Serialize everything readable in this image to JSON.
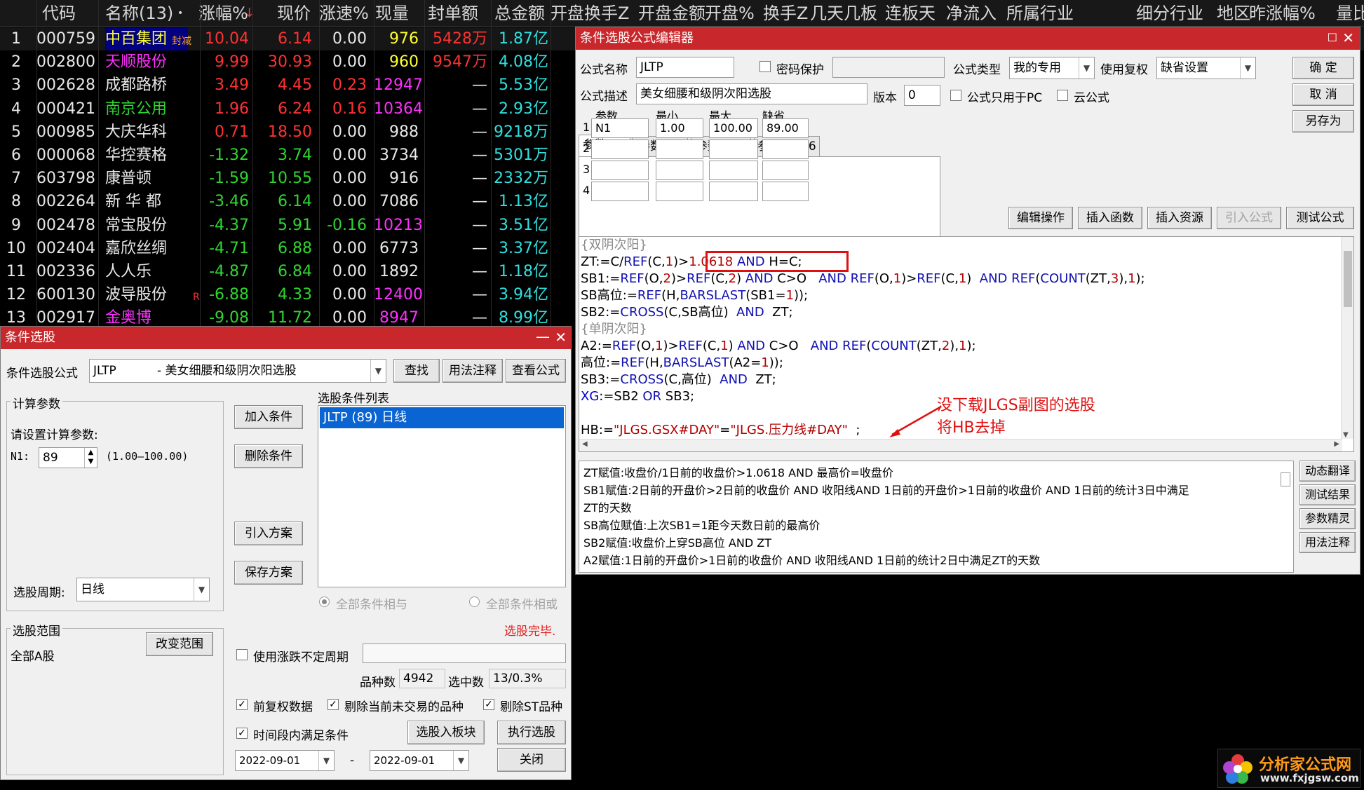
{
  "stock_table": {
    "headers": [
      "代码",
      "名称(13)",
      "•",
      "涨幅%",
      "现价",
      "涨速%",
      "现量",
      "封单额",
      "总金额",
      "开盘换手Z",
      "开盘金额",
      "开盘%",
      "换手Z",
      "几天几板",
      "连板天",
      "净流入",
      "所属行业",
      "细分行业",
      "地区",
      "昨涨幅%",
      "量比"
    ],
    "sort_indicator": "↓",
    "rows": [
      {
        "idx": "1",
        "code": "000759",
        "name": "中百集团",
        "flag": "封减",
        "chg": "10.04",
        "price": "6.14",
        "speed": "0.00",
        "vol": "976",
        "seal": "5428万",
        "amount": "1.87亿"
      },
      {
        "idx": "2",
        "code": "002800",
        "name": "天顺股份",
        "flag": "",
        "chg": "9.99",
        "price": "30.93",
        "speed": "0.00",
        "vol": "960",
        "seal": "9547万",
        "amount": "4.08亿"
      },
      {
        "idx": "3",
        "code": "002628",
        "name": "成都路桥",
        "flag": "",
        "chg": "3.49",
        "price": "4.45",
        "speed": "0.23",
        "vol": "12947",
        "seal": "—",
        "amount": "5.53亿"
      },
      {
        "idx": "4",
        "code": "000421",
        "name": "南京公用",
        "flag": "",
        "chg": "1.96",
        "price": "6.24",
        "speed": "0.16",
        "vol": "10364",
        "seal": "—",
        "amount": "2.93亿"
      },
      {
        "idx": "5",
        "code": "000985",
        "name": "大庆华科",
        "flag": "",
        "chg": "0.71",
        "price": "18.50",
        "speed": "0.00",
        "vol": "988",
        "seal": "—",
        "amount": "9218万"
      },
      {
        "idx": "6",
        "code": "000068",
        "name": "华控赛格",
        "flag": "",
        "chg": "-1.32",
        "price": "3.74",
        "speed": "0.00",
        "vol": "3734",
        "seal": "—",
        "amount": "5301万"
      },
      {
        "idx": "7",
        "code": "603798",
        "name": "康普顿",
        "flag": "",
        "chg": "-1.59",
        "price": "10.55",
        "speed": "0.00",
        "vol": "916",
        "seal": "—",
        "amount": "2332万"
      },
      {
        "idx": "8",
        "code": "002264",
        "name": "新 华 都",
        "flag": "",
        "chg": "-3.46",
        "price": "6.14",
        "speed": "0.00",
        "vol": "7086",
        "seal": "—",
        "amount": "1.13亿"
      },
      {
        "idx": "9",
        "code": "002478",
        "name": "常宝股份",
        "flag": "",
        "chg": "-4.37",
        "price": "5.91",
        "speed": "-0.16",
        "vol": "10213",
        "seal": "—",
        "amount": "3.51亿"
      },
      {
        "idx": "10",
        "code": "002404",
        "name": "嘉欣丝绸",
        "flag": "",
        "chg": "-4.71",
        "price": "6.88",
        "speed": "0.00",
        "vol": "6773",
        "seal": "—",
        "amount": "3.37亿"
      },
      {
        "idx": "11",
        "code": "002336",
        "name": "人人乐",
        "flag": "",
        "chg": "-4.87",
        "price": "6.84",
        "speed": "0.00",
        "vol": "1892",
        "seal": "—",
        "amount": "1.18亿"
      },
      {
        "idx": "12",
        "code": "600130",
        "name": "波导股份",
        "flag": "R",
        "chg": "-6.88",
        "price": "4.33",
        "speed": "0.00",
        "vol": "12400",
        "seal": "—",
        "amount": "3.94亿"
      },
      {
        "idx": "13",
        "code": "002917",
        "name": "金奥博",
        "flag": "",
        "chg": "-9.08",
        "price": "11.72",
        "speed": "0.00",
        "vol": "8947",
        "seal": "—",
        "amount": "8.99亿"
      }
    ]
  },
  "selector": {
    "title": "条件选股",
    "formula_label": "条件选股公式",
    "formula_value": "JLTP",
    "formula_desc": "- 美女细腰和级阴次阳选股",
    "find_btn": "查找",
    "usage_btn": "用法注释",
    "view_btn": "查看公式",
    "calc_group": "计算参数",
    "set_params_label": "请设置计算参数:",
    "n1_label": "N1:",
    "n1_value": "89",
    "n1_range": "(1.00—100.00)",
    "period_label": "选股周期:",
    "period_value": "日线",
    "add_btn": "加入条件",
    "del_btn": "删除条件",
    "import_btn": "引入方案",
    "save_btn": "保存方案",
    "list_label": "选股条件列表",
    "list_item": "JLTP (89) 日线",
    "and_label": "全部条件相与",
    "or_label": "全部条件相或",
    "done_label": "选股完毕.",
    "range_group": "选股范围",
    "range_value": "全部A股",
    "change_range_btn": "改变范围",
    "use_period_label": "使用涨跌不定周期",
    "count_label": "品种数",
    "count_value": "4942",
    "hit_label": "选中数",
    "hit_value": "13/0.3%",
    "fq_label": "前复权数据",
    "exclude_label": "剔除当前未交易的品种",
    "st_label": "剔除ST品种",
    "time_label": "时间段内满足条件",
    "to_block_btn": "选股入板块",
    "exec_btn": "执行选股",
    "date_from": "2022-09-01",
    "date_sep": "-",
    "date_to": "2022-09-01",
    "close_btn": "关闭"
  },
  "editor": {
    "title": "条件选股公式编辑器",
    "name_label": "公式名称",
    "name_value": "JLTP",
    "pwd_label": "密码保护",
    "type_label": "公式类型",
    "type_value": "我的专用",
    "fq_label": "使用复权",
    "fq_value": "缺省设置",
    "ok_btn": "确  定",
    "cancel_btn": "取  消",
    "saveas_btn": "另存为",
    "desc_label": "公式描述",
    "desc_value": "美女细腰和级阴次阳选股",
    "ver_label": "版本",
    "ver_value": "0",
    "pc_label": "公式只用于PC",
    "cloud_label": "云公式",
    "tabs": [
      "参数1-4",
      "参数5-8",
      "参数9-12",
      "参数13-16"
    ],
    "param_headers": [
      "参数",
      "最小",
      "最大",
      "缺省"
    ],
    "param_rows": [
      {
        "i": "1",
        "name": "N1",
        "min": "1.00",
        "max": "100.00",
        "def": "89.00"
      },
      {
        "i": "2",
        "name": "",
        "min": "",
        "max": "",
        "def": ""
      },
      {
        "i": "3",
        "name": "",
        "min": "",
        "max": "",
        "def": ""
      },
      {
        "i": "4",
        "name": "",
        "min": "",
        "max": "",
        "def": ""
      }
    ],
    "edit_btn": "编辑操作",
    "func_btn": "插入函数",
    "res_btn": "插入资源",
    "import_btn": "引入公式",
    "test_btn": "测试公式",
    "annotation": [
      "没下载JLGS副图的选股",
      "将HB去掉"
    ],
    "desc_lines": [
      "ZT赋值:收盘价/1日前的收盘价>1.0618 AND 最高价=收盘价",
      "SB1赋值:2日前的开盘价>2日前的收盘价 AND 收阳线AND 1日前的开盘价>1日前的收盘价   AND 1日前的统计3日中满足",
      "ZT的天数",
      "SB高位赋值:上次SB1=1距今天数日前的最高价",
      "SB2赋值:收盘价上穿SB高位  AND  ZT",
      "A2赋值:1日前的开盘价>1日前的收盘价 AND 收阳线AND 1日前的统计2日中满足ZT的天数"
    ],
    "side_btns": [
      "动态翻译",
      "测试结果",
      "参数精灵",
      "用法注释"
    ]
  },
  "watermark": {
    "text": "分析家公式网",
    "url": "www.fxjgsw.com"
  },
  "colors": {
    "title_bar": "#c8282b",
    "up": "#ff3232",
    "down": "#2fd62f",
    "cyan": "#30e0e0",
    "magenta": "#ff30ff",
    "yellow": "#ffff30"
  }
}
